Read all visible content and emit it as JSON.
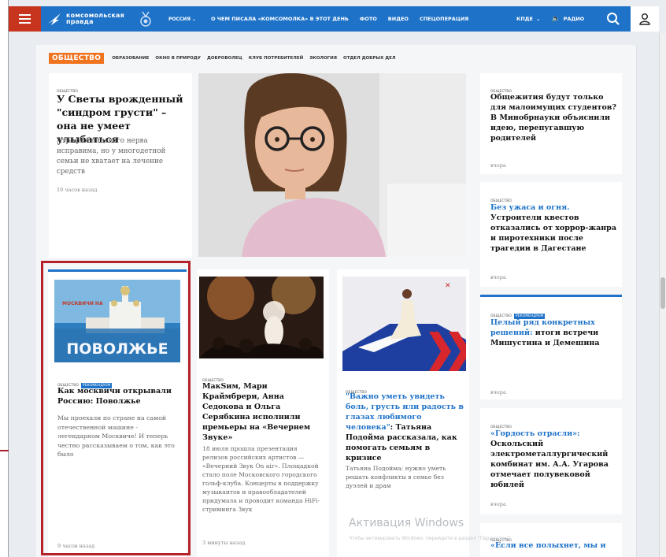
{
  "header": {
    "logo_line1": "комсомольская",
    "logo_line2": "правда",
    "region": "РОССИЯ",
    "nav": [
      "О ЧЕМ ПИСАЛА «КОМСОМОЛКА» В ЭТОТ ДЕНЬ",
      "ФОТО",
      "ВИДЕО",
      "СПЕЦОПЕРАЦИЯ"
    ],
    "rates": "КПДЕ",
    "radio": "РАДИО"
  },
  "rubrics": {
    "main": "ОБЩЕСТВО",
    "items": [
      "ОБРАЗОВАНИЕ",
      "ОКНО В ПРИРОДУ",
      "ДОБРОВОЛЕЦ",
      "КЛУБ ПОТРЕБИТЕЛЕЙ",
      "ЭКОЛОГИЯ",
      "ОТДЕЛ ДОБРЫХ ДЕЛ"
    ]
  },
  "tags": {
    "society": "общество",
    "recommend": "рекомендуем"
  },
  "lead_article": {
    "title": "У Светы врожденный \"синдром грусти\" – она не умеет улыбаться",
    "lead": "Атрофия лицевого нерва исправима, но у многодетной семьи не хватает на лечение средств",
    "time": "10 часов назад"
  },
  "card_volga": {
    "image_banner": "ПОВОЛЖЬЕ",
    "image_caption": "МОСКВИЧИ НА",
    "title": "Как москвичи открывали Россию: Поволжье",
    "lead": "Мы проехали по стране на самой отечественной машине - легендарном Москвиче! И теперь честно рассказываем о том, как это было",
    "time": "9 часов назад"
  },
  "card_concert": {
    "title": "МакSим, Мари Краймбрери, Анна Седокова и Ольга Серябкина исполнили премьеры на «Вечернем Звуке»",
    "lead": "18 июля прошла презентация релизов российских артистов — «Вечерний Звук On air». Площадкой стало поле Московского городского гольф-клуба. Концерты в поддержку музыкантов и правообладателей придумала и проводит команда HiFi-стриминга Звук",
    "time": "3 минуты назад"
  },
  "card_feelings": {
    "title_blue": "\"Важно уметь увидеть боль, грусть или радость в глазах любимого человека\"",
    "title_rest": ": Татьяна Подойма рассказала, как помогать семьям в кризисе",
    "lead": "Татьяна Подойма: нужно уметь решать конфликты в семье без дуэлей и драм"
  },
  "side": [
    {
      "title": "Общежития будут только для малоимущих студентов? В Минобрнауки объяснили идею, перепугавшую родителей",
      "blue": "",
      "time": "вчера"
    },
    {
      "blue": "Без ужаса и огня.",
      "title": " Устроители квестов отказались от хоррор-жанра и пиротехники после трагедии в Дагестане",
      "time": "вчера"
    },
    {
      "blue": "Целый ряд конкретных решений:",
      "title": " итоги встречи Мишустина и Демешина",
      "time": "вчера"
    },
    {
      "blue": "«Гордость отрасли»:",
      "title": " Оскольский электрометаллургический комбинат им. А.А. Угарова отмечает полувековой юбилей",
      "time": "вчера"
    },
    {
      "blue": "«Если все полыхнет, мы и",
      "title": "",
      "time": ""
    }
  ],
  "watermark": {
    "line1": "Активация Windows",
    "line2": "Чтобы активировать Windows, перейдите в раздел \"Параметры\"."
  },
  "colors": {
    "brand_blue": "#1e72c8",
    "burger_red": "#c8351e",
    "rubric_orange": "#f07420",
    "highlight_red": "#b5222b"
  }
}
